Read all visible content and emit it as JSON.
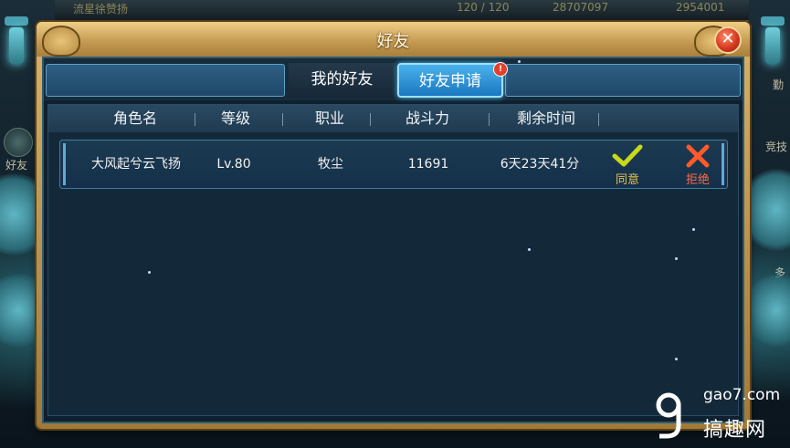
{
  "background": {
    "top_text": "流星徐赞扬",
    "top_stat_1": "120 / 120",
    "top_stat_2": "28707097",
    "top_stat_3": "2954001",
    "left_label": "好友",
    "right_label_1": "勤",
    "right_label_2": "竞技",
    "right_label_3": "多"
  },
  "dialog": {
    "title": "好友",
    "close_icon": "close-x-icon"
  },
  "tabs": [
    {
      "label": "我的好友",
      "active": false
    },
    {
      "label": "好友申请",
      "active": true,
      "badge": "!"
    }
  ],
  "table": {
    "headers": [
      "角色名",
      "等级",
      "职业",
      "战斗力",
      "剩余时间"
    ],
    "rows": [
      {
        "name": "大风起兮云飞扬",
        "level": "Lv.80",
        "class": "牧尘",
        "power": "11691",
        "remaining": "6天23天41分",
        "accept_label": "同意",
        "reject_label": "拒绝"
      }
    ]
  },
  "colors": {
    "accept": "#e8c24a",
    "reject": "#ff6a4a",
    "active_tab": "#1a78c0",
    "frame_gold": "#d9b36a"
  },
  "watermark": {
    "site": "gao7.com",
    "name": "搞趣网"
  }
}
